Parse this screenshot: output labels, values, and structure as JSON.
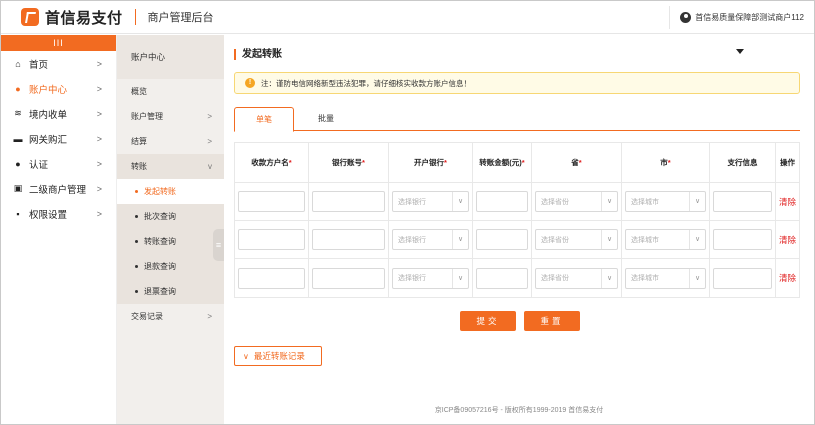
{
  "header": {
    "brand": "首信易支付",
    "subtitle": "商户管理后台",
    "user": "首信易质量保障部测试商户112",
    "accent": "#f26b21"
  },
  "leftnav": {
    "toggle": "III",
    "items": [
      {
        "label": "首页",
        "icon": "home-icon",
        "glyph": "⌂"
      },
      {
        "label": "账户中心",
        "icon": "user-icon",
        "glyph": "●",
        "active": true
      },
      {
        "label": "境内收单",
        "icon": "layers-icon",
        "glyph": "≋"
      },
      {
        "label": "网关购汇",
        "icon": "bank-icon",
        "glyph": "▬"
      },
      {
        "label": "认证",
        "icon": "person-icon",
        "glyph": "●"
      },
      {
        "label": "二级商户管理",
        "icon": "id-card-icon",
        "glyph": "▣"
      },
      {
        "label": "权限设置",
        "icon": "lock-icon",
        "glyph": "▪"
      }
    ],
    "arrow": ">"
  },
  "subnav": {
    "head": "账户中心",
    "items": [
      {
        "label": "概览"
      },
      {
        "label": "账户管理",
        "arrow": ">"
      },
      {
        "label": "结算",
        "arrow": ">"
      },
      {
        "label": "转账",
        "arrow": "v"
      }
    ],
    "children": [
      {
        "label": "发起转账",
        "active": true
      },
      {
        "label": "批次查询"
      },
      {
        "label": "转账查询"
      },
      {
        "label": "退款查询"
      },
      {
        "label": "退票查询"
      }
    ],
    "trade": {
      "label": "交易记录",
      "arrow": ">"
    },
    "collapse": "≡"
  },
  "main": {
    "title": "发起转账",
    "notice_icon": "!",
    "notice": "注：谨防电信网络新型违法犯罪，请仔细核实收款方账户信息！",
    "tabs": [
      "单笔",
      "批量"
    ],
    "columns": [
      {
        "label": "收款方户名",
        "required": "*"
      },
      {
        "label": "银行账号",
        "required": "*"
      },
      {
        "label": "开户银行",
        "required": "*"
      },
      {
        "label": "转账金额(元)",
        "required": "*"
      },
      {
        "label": "省",
        "required": "*"
      },
      {
        "label": "市",
        "required": "*"
      },
      {
        "label": "支行信息",
        "required": ""
      },
      {
        "label": "操作",
        "required": ""
      }
    ],
    "rows": [
      {
        "bank_placeholder": "选择银行",
        "province_placeholder": "选择省份",
        "city_placeholder": "选择城市",
        "action": "清除"
      },
      {
        "bank_placeholder": "选择银行",
        "province_placeholder": "选择省份",
        "city_placeholder": "选择城市",
        "action": "清除"
      },
      {
        "bank_placeholder": "选择银行",
        "province_placeholder": "选择省份",
        "city_placeholder": "选择城市",
        "action": "清除"
      }
    ],
    "select_caret": "∨",
    "submit": "提交",
    "reset": "重置",
    "recent": "最近转账记录",
    "recent_chevron": "∨",
    "footer": "京ICP备09057216号 - 版权所有1999-2019 首信易支付"
  }
}
